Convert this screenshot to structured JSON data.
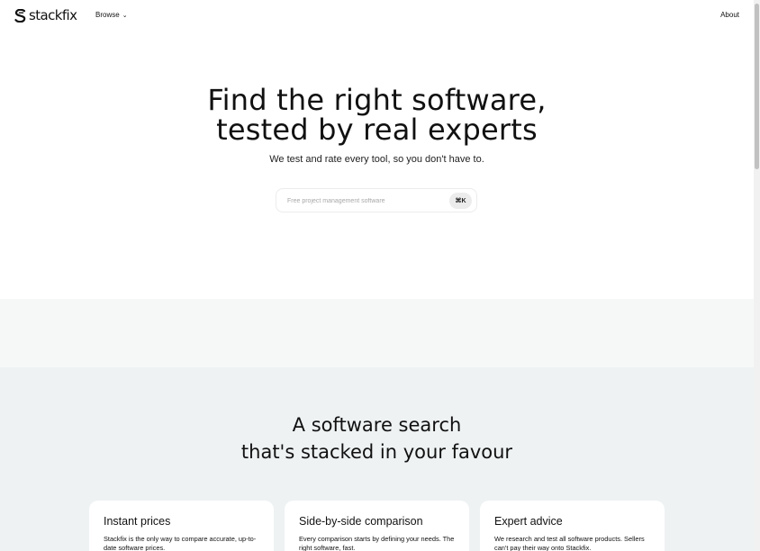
{
  "header": {
    "logo_text": "stackfix",
    "browse_label": "Browse",
    "about_label": "About"
  },
  "hero": {
    "title_line1": "Find the right software,",
    "title_line2": "tested by real experts",
    "subtitle": "We test and rate every tool, so you don't have to.",
    "search": {
      "placeholder": "Free project management software",
      "shortcut": "⌘K"
    }
  },
  "features": {
    "title_line1": "A software search",
    "title_line2": "that's stacked in your favour",
    "cards": [
      {
        "title": "Instant prices",
        "text": "Stackfix is the only way to compare accurate, up-to-date software prices."
      },
      {
        "title": "Side-by-side comparison",
        "text": "Every comparison starts by defining your needs. The right software, fast."
      },
      {
        "title": "Expert advice",
        "text": "We research and test all software products. Sellers can't pay their way onto Stackfix."
      }
    ]
  },
  "icons": {
    "logo": "stackfix-logo-icon",
    "browse_chevron": "chevron-down-icon"
  },
  "colors": {
    "text": "#111111",
    "band_light": "#f6f8f8",
    "section_bg": "#eef2f3",
    "card_bg": "#ffffff",
    "kbd_bg": "#ececec"
  }
}
